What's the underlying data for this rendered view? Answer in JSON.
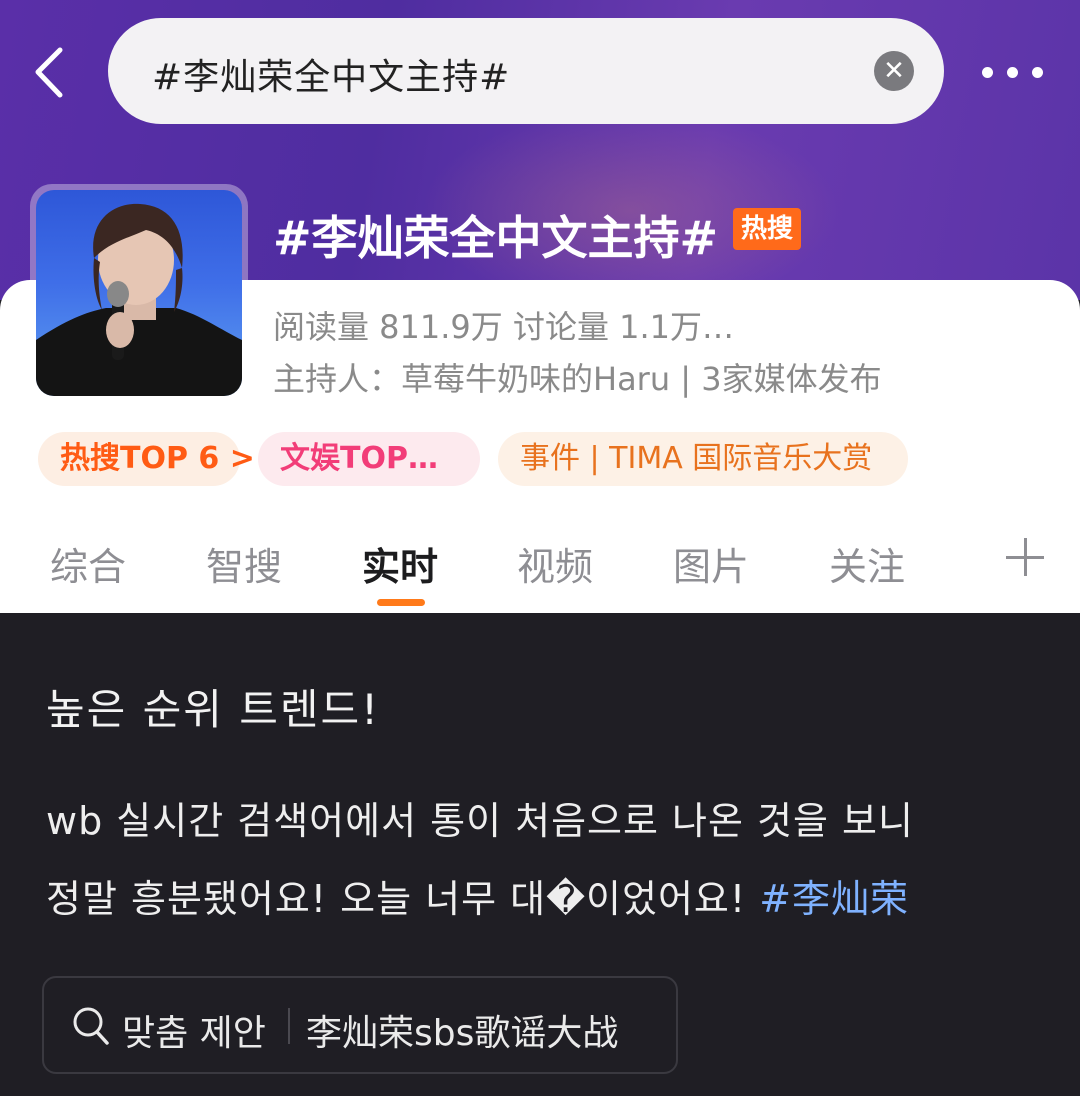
{
  "search": {
    "query": "#李灿荣全中文主持#"
  },
  "topic": {
    "title": "#李灿荣全中文主持#",
    "badge": "热搜",
    "stats": "阅读量 811.9万  讨论量 1.1万…",
    "host": "主持人：草莓牛奶味的Haru | 3家媒体发布"
  },
  "chips": [
    {
      "label": "热搜TOP 6 >"
    },
    {
      "label": "文娱TOP…"
    },
    {
      "label": "事件 | TIMA 国际音乐大赏"
    }
  ],
  "tabs": [
    {
      "label": "综合"
    },
    {
      "label": "智搜"
    },
    {
      "label": "实时"
    },
    {
      "label": "视频"
    },
    {
      "label": "图片"
    },
    {
      "label": "关注"
    }
  ],
  "active_tab": "实时",
  "post": {
    "heading": "높은 순위 트렌드!",
    "line1": "wb 실시간 검색어에서 통이 처음으로 나온 것을 보니",
    "line2_text": "정말 흥분됐어요! 오늘 너무 대�이었어요! ",
    "line2_hashtag": "#李灿荣"
  },
  "suggestion": {
    "label": "맞춤 제안",
    "value": "李灿荣sbs歌谣大战"
  },
  "colors": {
    "accent_orange": "#ff7a1a",
    "hot_badge": "#ff6a1a",
    "hashtag_blue": "#7fb2ff",
    "header_purple": "#5a2fa8"
  }
}
